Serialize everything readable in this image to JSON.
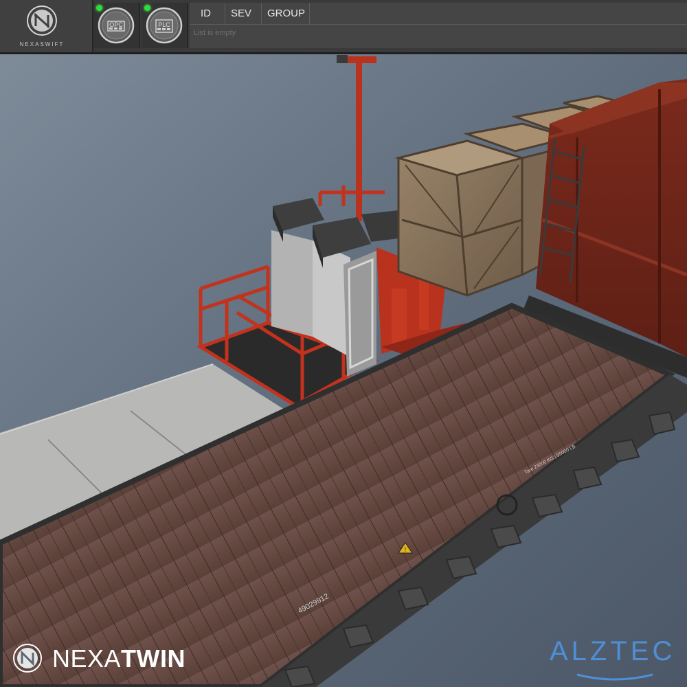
{
  "header": {
    "logo_text": "NEXASWIFT",
    "connections": [
      {
        "label": "OPC",
        "status_color": "#2fdc38"
      },
      {
        "label": "PLC",
        "status_color": "#2fdc38"
      }
    ]
  },
  "alarms": {
    "columns": [
      "ID",
      "SEV",
      "GROUP"
    ],
    "empty_text": "List is empty"
  },
  "scene": {
    "wagon_number": "49029912",
    "wagon_spec": "Tare 23000 KG | 55000 LB",
    "warning_sign": "!"
  },
  "branding": {
    "left_light": "NEXA",
    "left_bold": "TWIN",
    "right": "ALZTEC"
  },
  "colors": {
    "accent_red": "#b8321e",
    "status_green": "#2fdc38",
    "alztec_blue": "#4f8fd6"
  }
}
